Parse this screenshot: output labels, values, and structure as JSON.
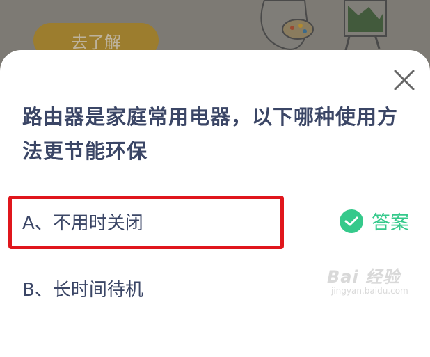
{
  "background": {
    "learn_button": "去了解"
  },
  "sheet": {
    "question": "路由器是家庭常用电器，以下哪种使用方法更节能环保",
    "options": [
      {
        "label": "A、不用时关闭",
        "is_answer": true
      },
      {
        "label": "B、长时间待机",
        "is_answer": false
      }
    ],
    "answer_label": "答案",
    "colors": {
      "accent": "#35c98b",
      "highlight": "#e0161c",
      "text": "#3b4666"
    }
  },
  "watermark": {
    "main": "Bai 经验",
    "sub": "jingyan.baidu.com"
  }
}
